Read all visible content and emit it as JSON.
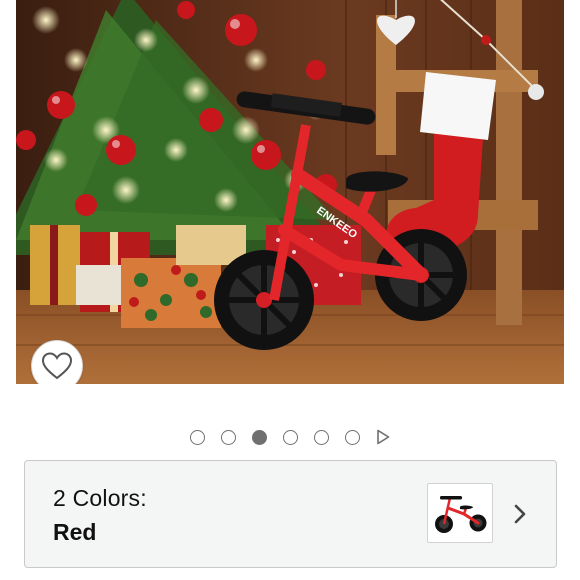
{
  "product_image": {
    "alt": "Red balance bike in front of a Christmas tree",
    "bike_brand_text": "ENKEEO",
    "accent_color": "#e2262a"
  },
  "favorite": {
    "icon": "heart-outline-icon"
  },
  "carousel": {
    "total_images": 6,
    "active_index": 2,
    "has_video": true
  },
  "variant": {
    "count_label": "2 Colors:",
    "selected_label": "Red",
    "thumbnail_icon": "balance-bike-thumbnail",
    "chevron_icon": "chevron-right-icon"
  }
}
